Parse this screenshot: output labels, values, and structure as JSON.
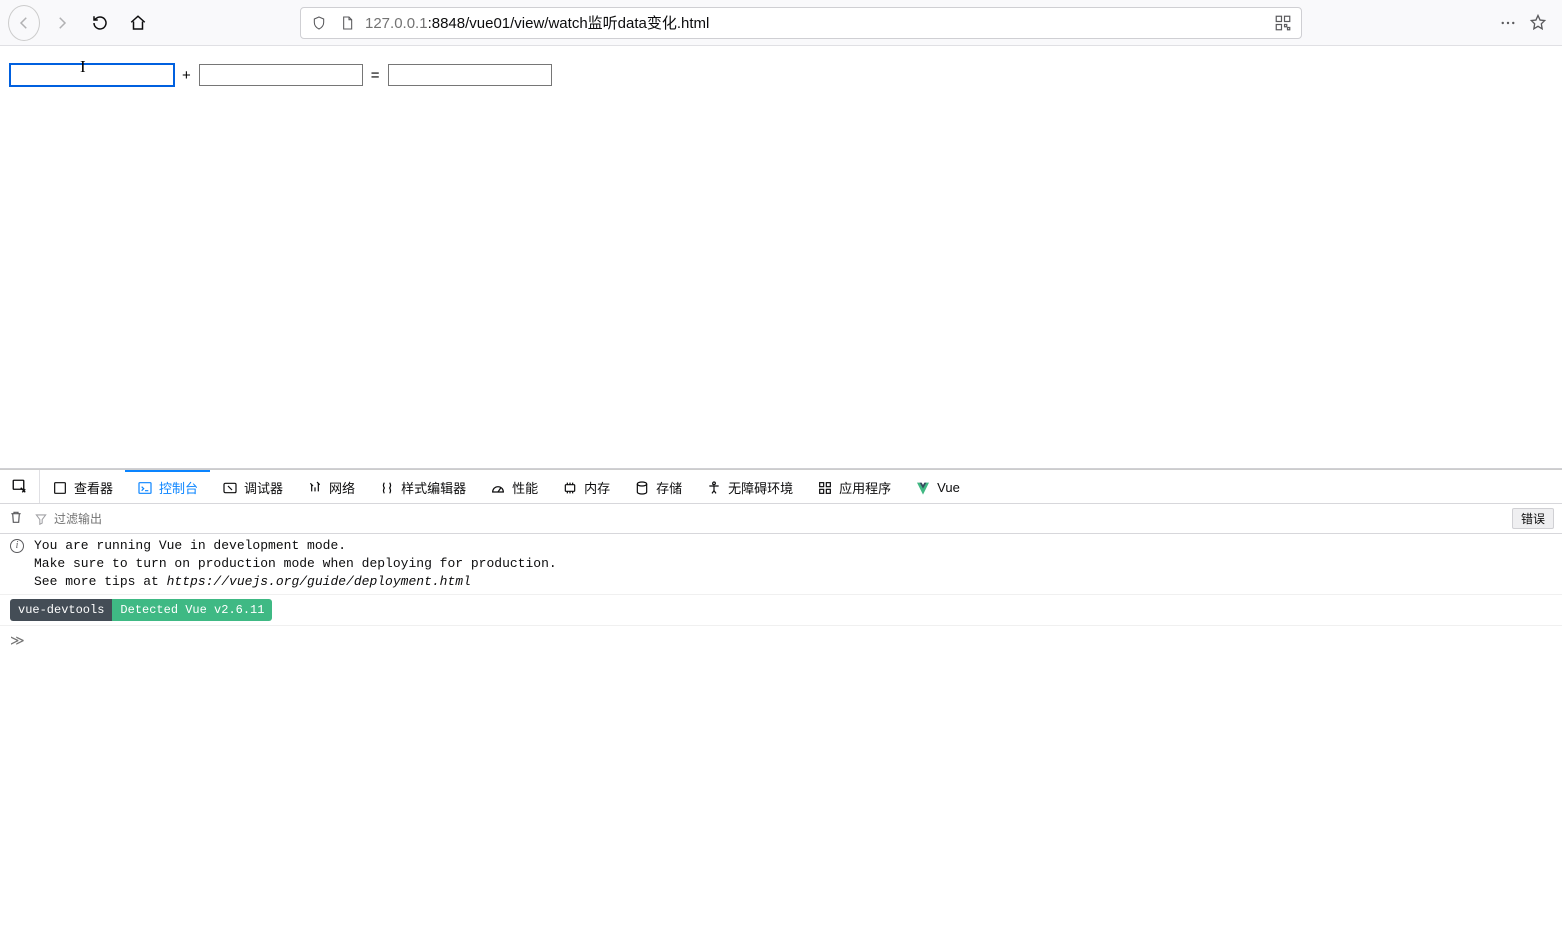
{
  "browser": {
    "url_dim_prefix": "127.0.0.1",
    "url_rest": ":8848/vue01/view/watch监听data变化.html"
  },
  "page": {
    "input1_value": "",
    "op_plus": "+",
    "input2_value": "",
    "op_eq": "=",
    "input3_value": ""
  },
  "devtools": {
    "tabs": {
      "inspector": "查看器",
      "console": "控制台",
      "debugger": "调试器",
      "network": "网络",
      "styles": "样式编辑器",
      "perf": "性能",
      "memory": "内存",
      "storage": "存储",
      "a11y": "无障碍环境",
      "apps": "应用程序",
      "vue": "Vue"
    },
    "filter_placeholder": "过滤输出",
    "error_button": "错误",
    "console": {
      "line1": "You are running Vue in development mode.",
      "line2": "Make sure to turn on production mode when deploying for production.",
      "line3_prefix": "See more tips at ",
      "line3_link": "https://vuejs.org/guide/deployment.html",
      "badge_name": "vue-devtools",
      "badge_detect": " Detected Vue v2.6.11 "
    },
    "prompt": "≫"
  }
}
